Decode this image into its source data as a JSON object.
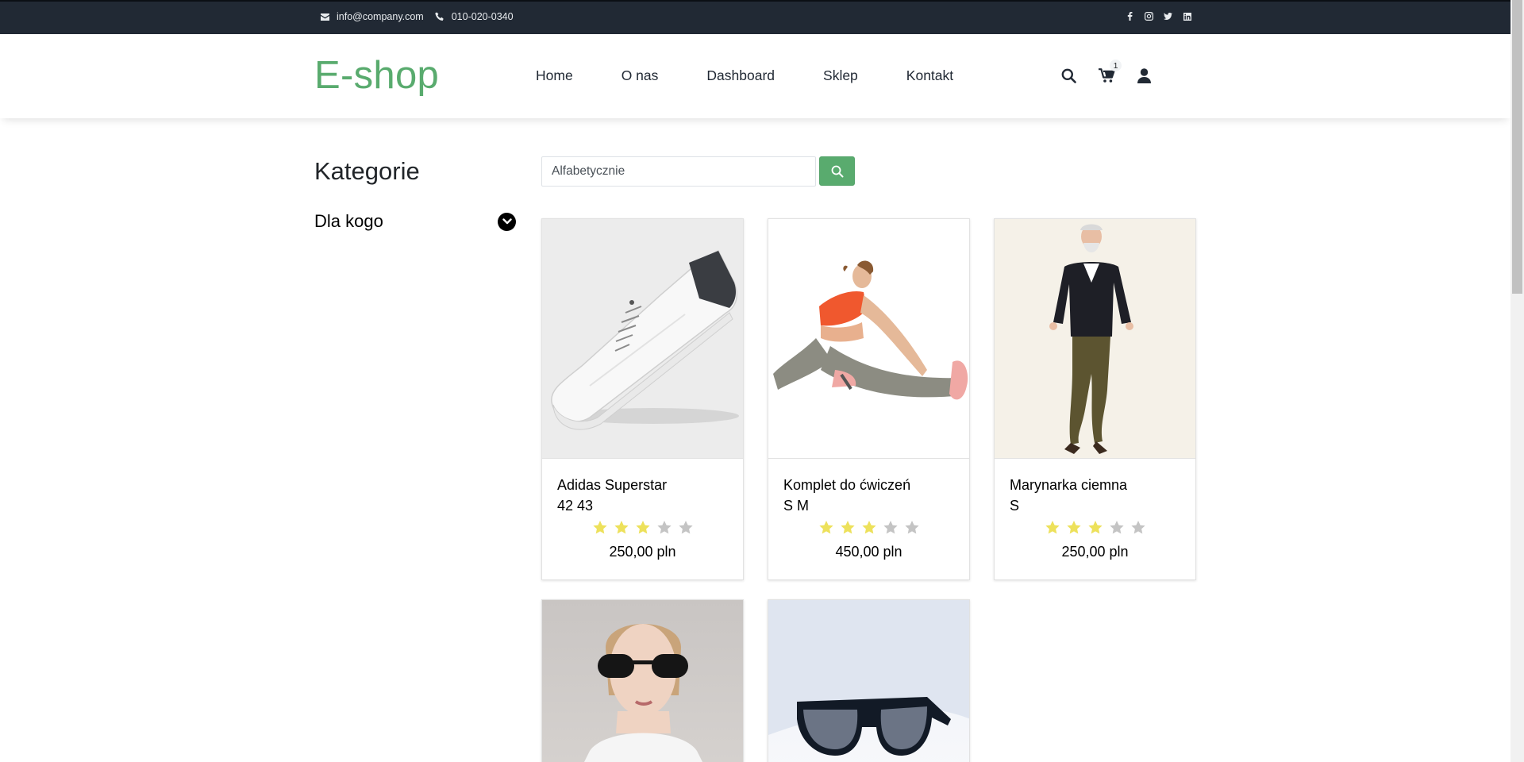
{
  "topbar": {
    "email": "info@company.com",
    "phone": "010-020-0340",
    "social": [
      "facebook-icon",
      "instagram-icon",
      "twitter-icon",
      "linkedin-icon"
    ]
  },
  "header": {
    "logo": "E-shop",
    "nav": [
      "Home",
      "O nas",
      "Dashboard",
      "Sklep",
      "Kontakt"
    ],
    "cart_count": "1"
  },
  "sidebar": {
    "title": "Kategorie",
    "category": "Dla kogo"
  },
  "search": {
    "value": "Alfabetycznie"
  },
  "products": [
    {
      "name": "Adidas Superstar",
      "sizes": "42 43",
      "rating": 3,
      "max_rating": 5,
      "price": "250,00 pln"
    },
    {
      "name": "Komplet do ćwiczeń",
      "sizes": "S M",
      "rating": 3,
      "max_rating": 5,
      "price": "450,00 pln"
    },
    {
      "name": "Marynarka ciemna",
      "sizes": "S",
      "rating": 3,
      "max_rating": 5,
      "price": "250,00 pln"
    }
  ],
  "colors": {
    "brand": "#59ab6e",
    "topbar": "#212934",
    "star_filled": "#ede15b",
    "star_empty": "#c4c4c4"
  }
}
